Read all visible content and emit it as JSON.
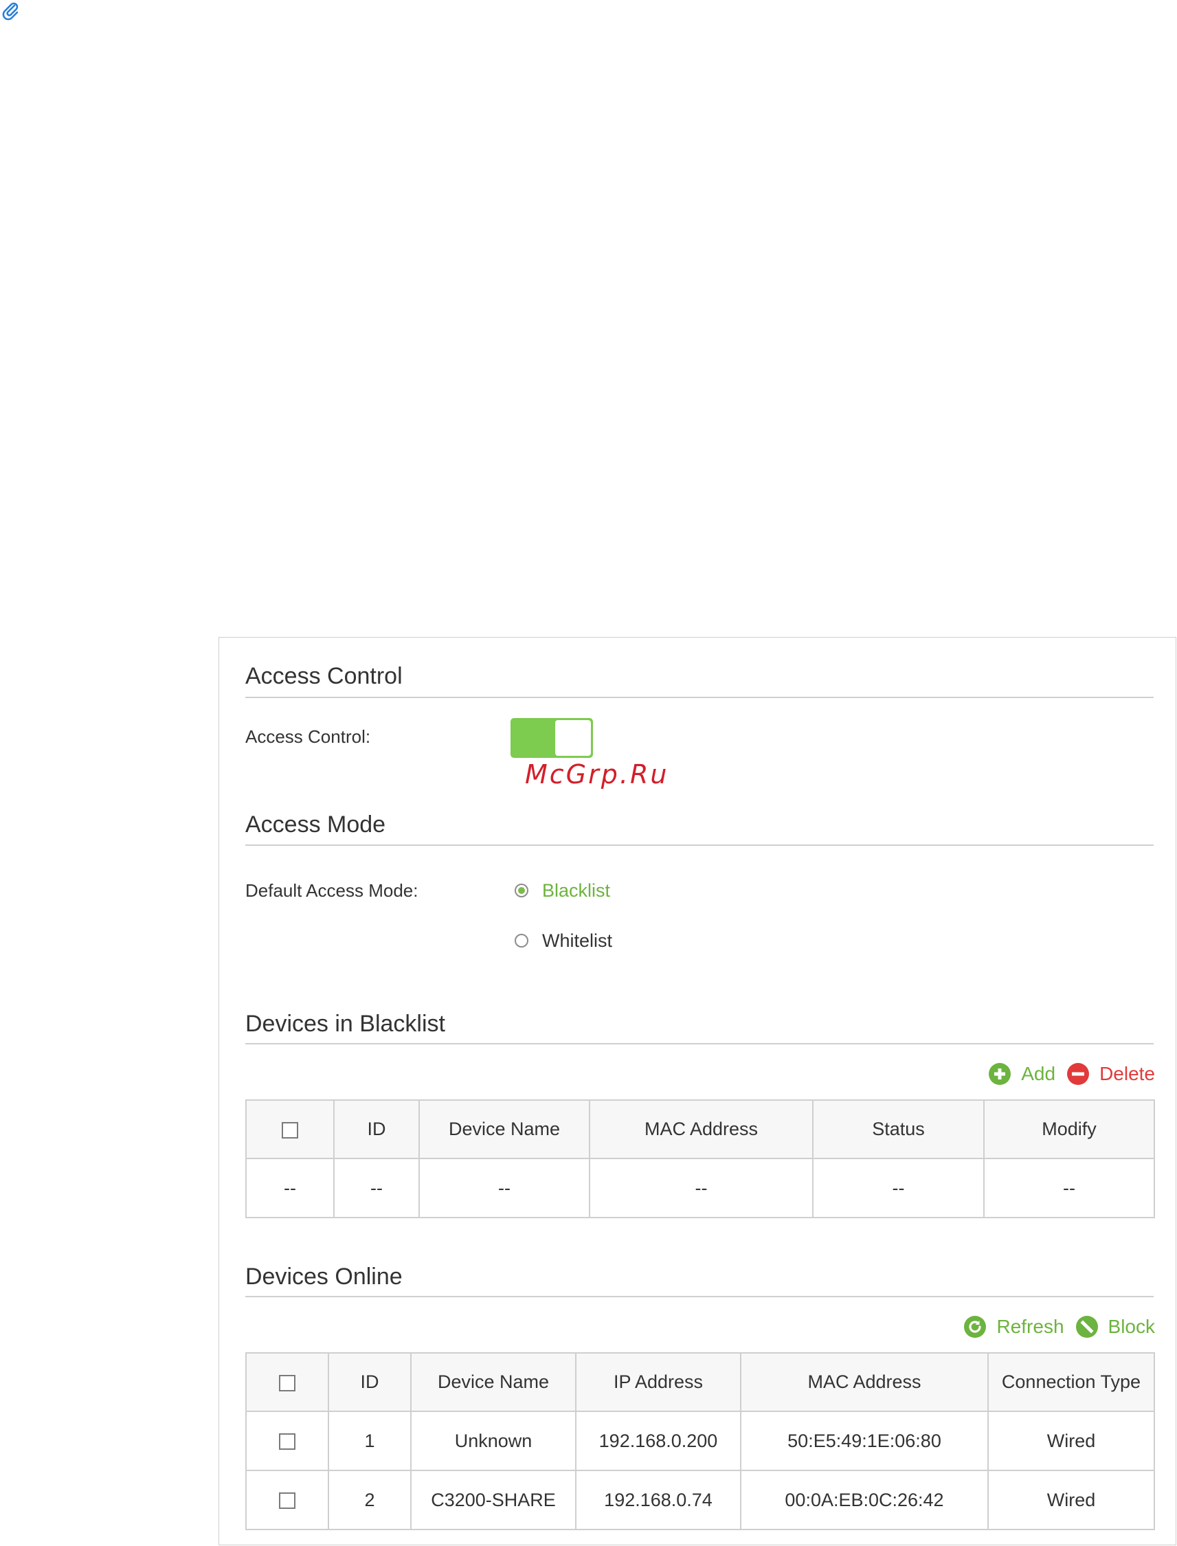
{
  "watermark": "McGrp.Ru",
  "access_control": {
    "title": "Access Control",
    "label": "Access Control:",
    "enabled": true
  },
  "access_mode": {
    "title": "Access Mode",
    "label": "Default Access Mode:",
    "options": [
      {
        "label": "Blacklist",
        "selected": true
      },
      {
        "label": "Whitelist",
        "selected": false
      }
    ]
  },
  "blacklist": {
    "title": "Devices in Blacklist",
    "add_label": "Add",
    "delete_label": "Delete",
    "columns": [
      "ID",
      "Device Name",
      "MAC Address",
      "Status",
      "Modify"
    ],
    "rows": [
      {
        "select": "--",
        "id": "--",
        "name": "--",
        "mac": "--",
        "status": "--",
        "modify": "--"
      }
    ]
  },
  "online": {
    "title": "Devices Online",
    "refresh_label": "Refresh",
    "block_label": "Block",
    "columns": [
      "ID",
      "Device Name",
      "IP Address",
      "MAC Address",
      "Connection Type"
    ],
    "rows": [
      {
        "id": "1",
        "name": "Unknown",
        "ip": "192.168.0.200",
        "mac": "50:E5:49:1E:06:80",
        "type": "Wired"
      },
      {
        "id": "2",
        "name": "C3200-SHARE",
        "ip": "192.168.0.74",
        "mac": "00:0A:EB:0C:26:42",
        "type": "Wired"
      }
    ]
  },
  "colors": {
    "accent_green": "#7dcb4f",
    "text_green": "#6db33f",
    "delete_red": "#e23a3a",
    "border": "#cfcfcf"
  }
}
